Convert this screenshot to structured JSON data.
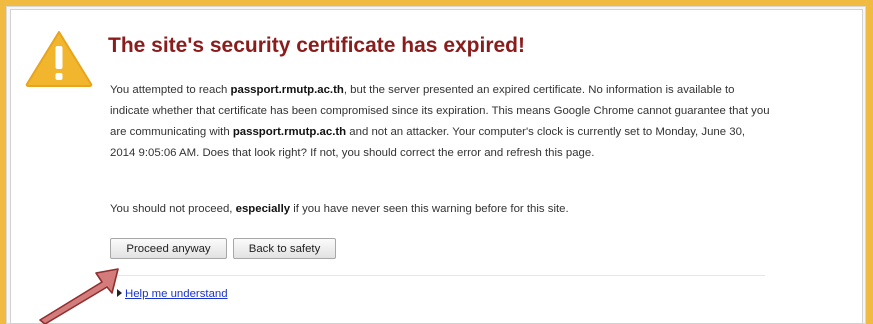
{
  "page": {
    "title": "The site's security certificate has expired!",
    "paragraph1": {
      "part1": "You attempted to reach ",
      "host1": "passport.rmutp.ac.th",
      "part2": ", but the server presented an expired certificate. No information is available to indicate whether that certificate has been compromised since its expiration. This means Google Chrome cannot guarantee that you are communicating with ",
      "host2": "passport.rmutp.ac.th",
      "part3": " and not an attacker. Your computer's clock is currently set to Monday, June 30, 2014 9:05:06 AM. Does that look right? If not, you should correct the error and refresh this page."
    },
    "paragraph2": {
      "part1": "You should not proceed, ",
      "emphasis": "especially",
      "part2": " if you have never seen this warning before for this site."
    },
    "buttons": {
      "proceed": "Proceed anyway",
      "back": "Back to safety"
    },
    "help_link": "Help me understand"
  },
  "colors": {
    "outer_border": "#f0bb40",
    "title": "#8a1c1c",
    "link": "#1a33cc",
    "warning_icon": "#f2b52e",
    "annotation_arrow": "#d47c7c"
  },
  "icons": {
    "warning": "warning-triangle-icon",
    "disclosure": "disclosure-triangle-icon",
    "annotation": "annotation-arrow-icon"
  }
}
